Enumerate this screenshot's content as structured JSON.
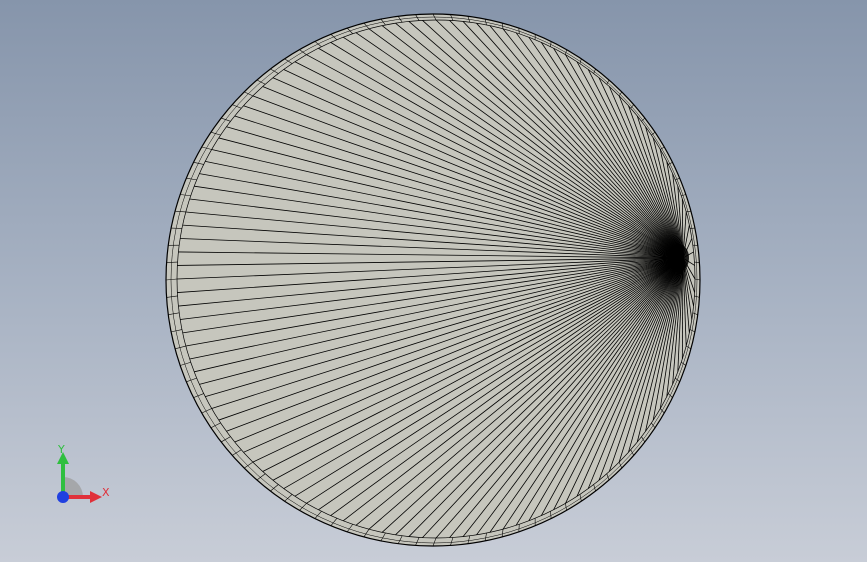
{
  "scene": {
    "background_top": "#8695ab",
    "background_bottom": "#c8cdd7",
    "face_color": "#c6c6bd",
    "edge_color": "#000000",
    "object": "circular-faceted-disc"
  },
  "triad": {
    "x_label": "X",
    "y_label": "Y",
    "x_color": "#e0303a",
    "y_color": "#2fbf3f",
    "z_color": "#2040e0"
  }
}
